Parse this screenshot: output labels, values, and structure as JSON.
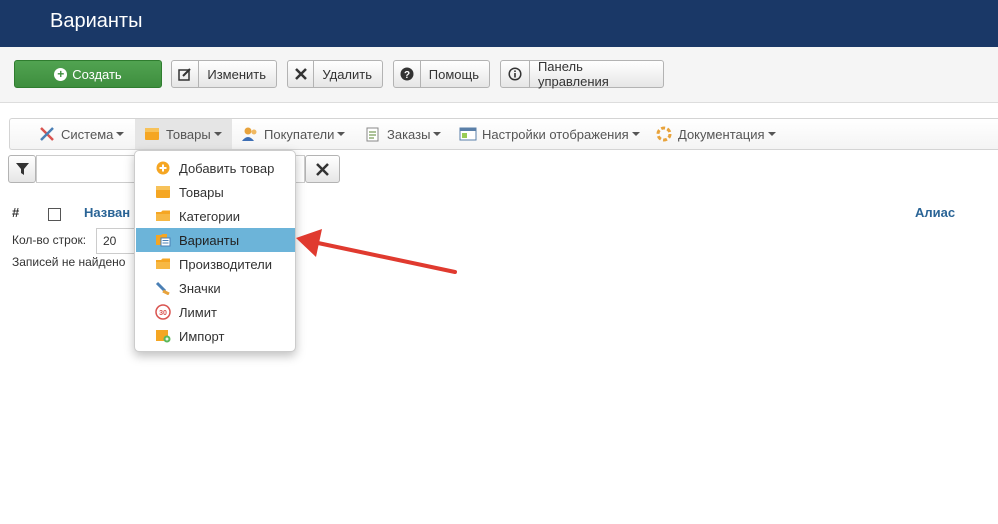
{
  "header": {
    "title": "Варианты"
  },
  "toolbar": {
    "create_label": "Создать",
    "edit_label": "Изменить",
    "delete_label": "Удалить",
    "help_label": "Помощь",
    "control_panel_label": "Панель управления"
  },
  "menubar": {
    "items": [
      {
        "label": "Система",
        "icon": "tools-icon"
      },
      {
        "label": "Товары",
        "icon": "box-icon"
      },
      {
        "label": "Покупатели",
        "icon": "users-icon"
      },
      {
        "label": "Заказы",
        "icon": "orders-icon"
      },
      {
        "label": "Настройки отображения",
        "icon": "display-settings-icon"
      },
      {
        "label": "Документация",
        "icon": "lifebuoy-icon"
      }
    ]
  },
  "dropdown": {
    "items": [
      {
        "label": "Добавить товар",
        "icon": "add-circle-icon"
      },
      {
        "label": "Товары",
        "icon": "box-icon"
      },
      {
        "label": "Категории",
        "icon": "folder-icon"
      },
      {
        "label": "Варианты",
        "icon": "variants-icon"
      },
      {
        "label": "Производители",
        "icon": "folder-icon"
      },
      {
        "label": "Значки",
        "icon": "badge-icon"
      },
      {
        "label": "Лимит",
        "icon": "limit-icon"
      },
      {
        "label": "Импорт",
        "icon": "import-icon"
      }
    ],
    "selected": "Варианты",
    "limit_icon_text": "30"
  },
  "table": {
    "hash": "#",
    "name_header": "Назван",
    "alias_header": "Алиас",
    "rows_label": "Кол-во строк:",
    "rows_value": "20",
    "empty_message": "Записей не найдено"
  },
  "colors": {
    "header_bg": "#1a3867",
    "create_green": "#46a046",
    "selected_item": "#6cb4d9",
    "arrow_red": "#e03a2f",
    "link_blue": "#2a6496"
  }
}
